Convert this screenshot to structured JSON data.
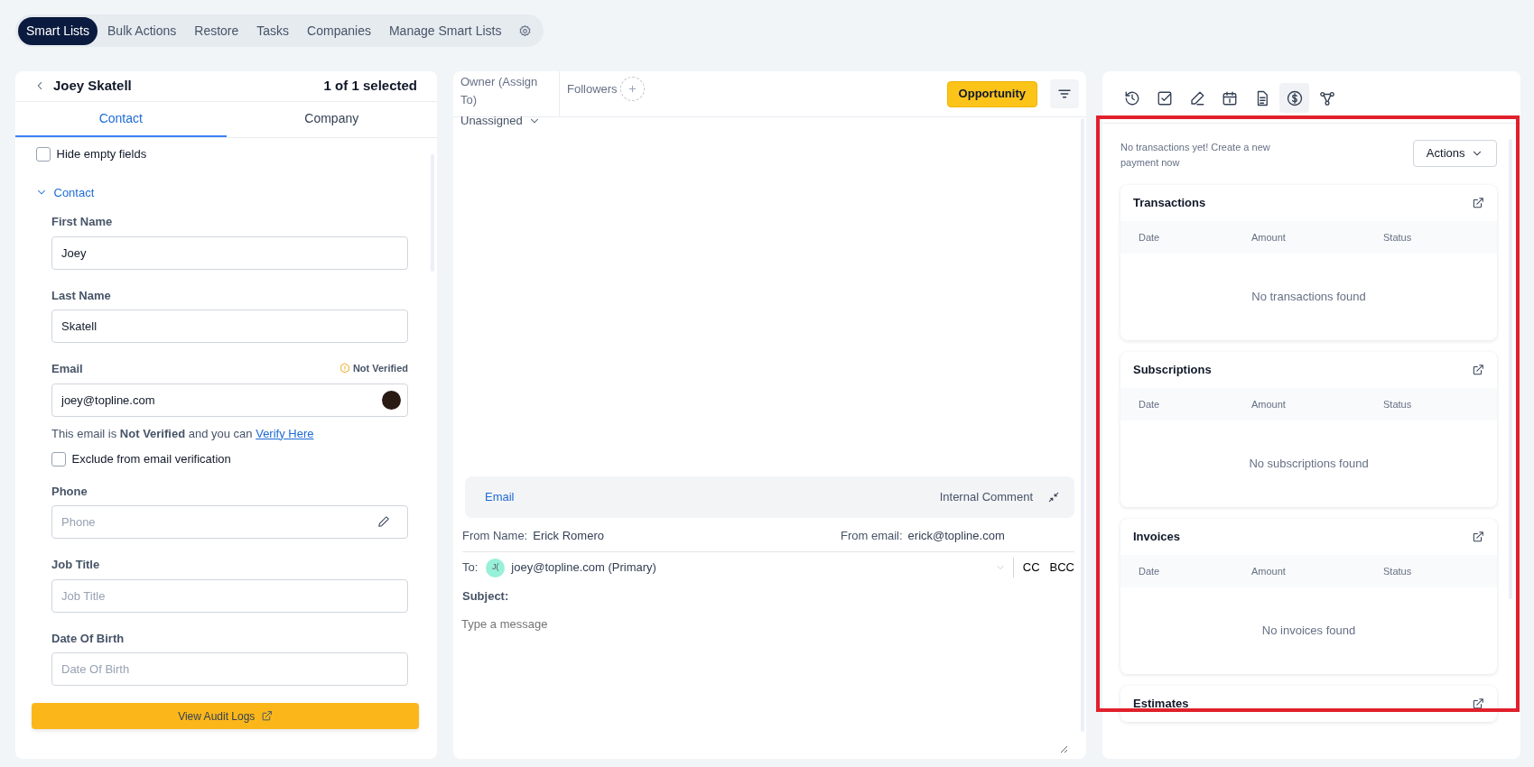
{
  "top_nav": {
    "tabs": [
      {
        "label": "Smart Lists",
        "selected": true
      },
      {
        "label": "Bulk Actions",
        "selected": false
      },
      {
        "label": "Restore",
        "selected": false
      },
      {
        "label": "Tasks",
        "selected": false
      },
      {
        "label": "Companies",
        "selected": false
      },
      {
        "label": "Manage Smart Lists",
        "selected": false
      }
    ]
  },
  "contact_panel": {
    "title": "Joey Skatell",
    "selection_count": "1 of 1 selected",
    "tabs": [
      {
        "label": "Contact",
        "selected": true
      },
      {
        "label": "Company",
        "selected": false
      }
    ],
    "hide_empty_fields": {
      "label": "Hide empty fields",
      "checked": false
    },
    "section": {
      "title": "Contact",
      "expanded": true
    },
    "fields": [
      {
        "kind": "text",
        "label": "First Name",
        "value": "Joey"
      },
      {
        "kind": "text",
        "label": "Last Name",
        "value": "Skatell"
      },
      {
        "kind": "email",
        "label": "Email",
        "value": "joey@topline.com",
        "badge": "Not Verified",
        "note": "This email is **Not Verified** and you can",
        "link": "Verify Here",
        "exclude": {
          "label": "Exclude from email verification",
          "checked": false
        }
      },
      {
        "kind": "phone",
        "label": "Phone",
        "placeholder": "Phone"
      },
      {
        "kind": "text",
        "label": "Job Title",
        "placeholder": "Job Title"
      },
      {
        "kind": "text",
        "label": "Date Of Birth",
        "placeholder": "Date Of Birth"
      }
    ],
    "audit_button": "View Audit Logs"
  },
  "conversation": {
    "owner_label": "Owner (Assign To)",
    "owner": "Unassigned",
    "followers_label": "Followers",
    "opportunity_button": "Opportunity",
    "composer": {
      "tabs": [
        {
          "label": "Email",
          "selected": true
        },
        {
          "label": "Internal Comment",
          "selected": false
        }
      ],
      "from_name_label": "From Name:",
      "from_name": "Erick Romero",
      "from_email_label": "From email:",
      "from_email": "erick@topline.com",
      "to_label": "To:",
      "recipient_initials": "J(",
      "recipient": "joey@topline.com (Primary)",
      "cc": "CC",
      "bcc": "BCC",
      "subject_label": "Subject:",
      "message_placeholder": "Type a message"
    }
  },
  "payments_panel": {
    "icon_tabs": [
      {
        "selected": false
      },
      {
        "selected": false
      },
      {
        "selected": false
      },
      {
        "selected": false
      },
      {
        "selected": false
      },
      {
        "selected": true
      },
      {
        "selected": false
      }
    ],
    "empty_message": "No transactions yet! Create a new payment now",
    "actions_button": "Actions",
    "sections": [
      {
        "title": "Transactions",
        "columns": [
          "Date",
          "Amount",
          "Status"
        ],
        "empty_text": "No transactions found"
      },
      {
        "title": "Subscriptions",
        "columns": [
          "Date",
          "Amount",
          "Status"
        ],
        "empty_text": "No subscriptions found"
      },
      {
        "title": "Invoices",
        "columns": [
          "Date",
          "Amount",
          "Status"
        ],
        "empty_text": "No invoices found"
      },
      {
        "title": "Estimates"
      }
    ]
  }
}
